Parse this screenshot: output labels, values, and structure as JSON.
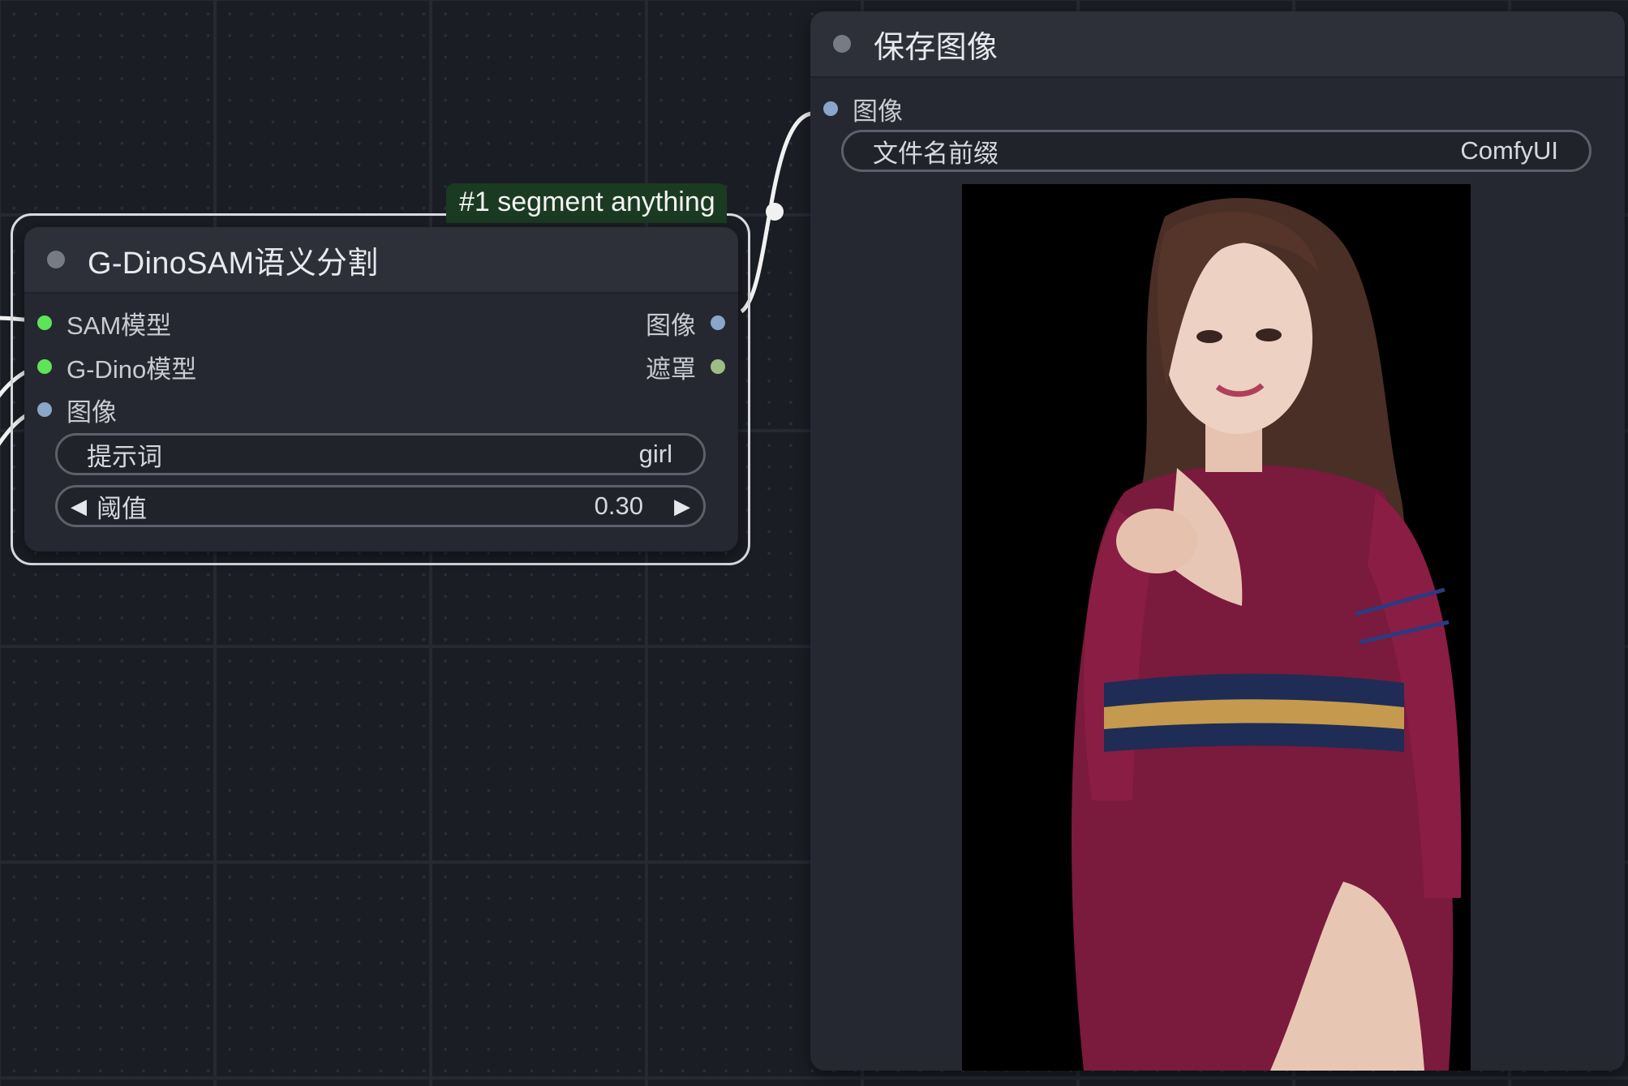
{
  "canvas": {
    "background": "#1b1d24"
  },
  "sam_node": {
    "title": "G-DinoSAM语义分割",
    "badge": "#1 segment anything",
    "inputs": [
      {
        "label": "SAM模型",
        "color": "#5ee35a"
      },
      {
        "label": "G-Dino模型",
        "color": "#5ee35a"
      },
      {
        "label": "图像",
        "color": "#8aa6c8"
      }
    ],
    "outputs": [
      {
        "label": "图像",
        "color": "#8aa6c8"
      },
      {
        "label": "遮罩",
        "color": "#9dbd84"
      }
    ],
    "prompt": {
      "label": "提示词",
      "value": "girl"
    },
    "threshold": {
      "label": "阈值",
      "value": "0.30",
      "dec_icon": "triangle-left-icon",
      "inc_icon": "triangle-right-icon"
    }
  },
  "save_node": {
    "title": "保存图像",
    "input": {
      "label": "图像",
      "color": "#8aa6c8"
    },
    "filename_prefix": {
      "label": "文件名前缀",
      "value": "ComfyUI"
    },
    "preview": {
      "description": "segmented output image"
    }
  },
  "colors": {
    "wire": "#f1f1f1",
    "selection": "#d9dbe0",
    "badge_bg": "#1b3a22"
  }
}
